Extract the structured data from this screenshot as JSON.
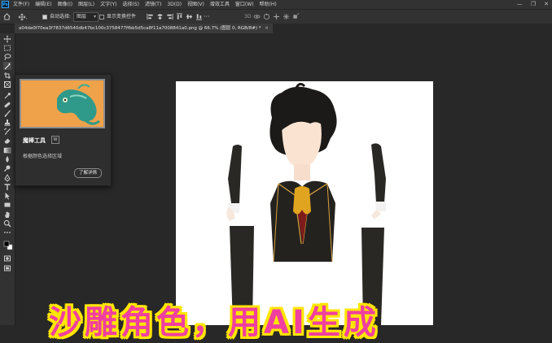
{
  "app": {
    "logo": "Ps"
  },
  "menubar": {
    "items": [
      "文件(F)",
      "编辑(E)",
      "图像(I)",
      "图层(L)",
      "文字(Y)",
      "选择(S)",
      "滤镜(T)",
      "3D(D)",
      "视图(V)",
      "增效工具",
      "窗口(W)",
      "帮助(H)"
    ]
  },
  "window_controls": {
    "minimize": "—",
    "restore": "❐",
    "close": "✕"
  },
  "options_bar": {
    "auto_select_label": "自动选择:",
    "layer_select_value": "图层",
    "show_transform_label": "显示变换控件"
  },
  "document_tab": {
    "title": "a04de0f70ea3f7837d6540db47bc100c3758477ffbb5d5ca8f11a7008841a0.png @ 66.7% (图层 0, RGB/8#) *",
    "close": "×"
  },
  "tooltip": {
    "title": "魔棒工具",
    "shortcut": "W",
    "description": "根据颜色选择区域",
    "learn_more": "了解详情"
  },
  "caption": {
    "text": "沙雕角色，用AI生成"
  },
  "colors": {
    "caption": "#f03fa0",
    "caption_outline": "#ffe600",
    "tooltip_bg": "#f0a24a"
  },
  "icons": [
    "move-icon",
    "marquee-icon",
    "lasso-icon",
    "magic-wand-icon",
    "crop-icon",
    "frame-icon",
    "eyedropper-icon",
    "healing-brush-icon",
    "brush-icon",
    "clone-stamp-icon",
    "history-brush-icon",
    "eraser-icon",
    "gradient-icon",
    "blur-icon",
    "dodge-icon",
    "pen-icon",
    "type-icon",
    "path-select-icon",
    "shape-icon",
    "hand-icon",
    "zoom-icon",
    "more-icon",
    "color-swatch-icon",
    "quick-mask-icon",
    "screen-mode-icon"
  ]
}
